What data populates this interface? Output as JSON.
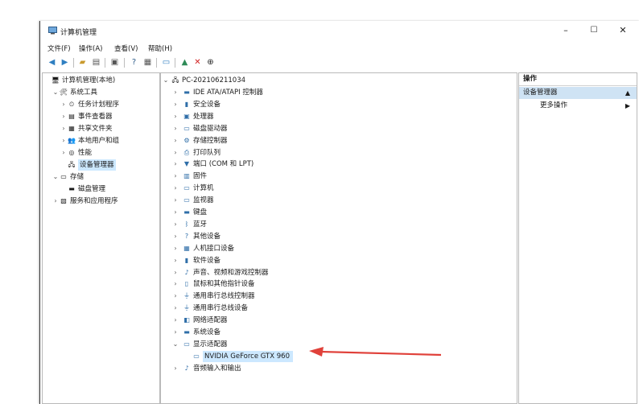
{
  "window": {
    "title": "计算机管理",
    "minimize": "–",
    "maximize": "☐",
    "close": "✕"
  },
  "menu": [
    "文件(F)",
    "操作(A)",
    "查看(V)",
    "帮助(H)"
  ],
  "left_tree": [
    {
      "label": "计算机管理(本地)",
      "level": 0,
      "chev": "",
      "icon": "computer-management-icon",
      "glyph": "🖥"
    },
    {
      "label": "系统工具",
      "level": 1,
      "chev": "v",
      "icon": "system-tools-icon",
      "glyph": "🛠"
    },
    {
      "label": "任务计划程序",
      "level": 2,
      "chev": ">",
      "icon": "task-scheduler-icon",
      "glyph": "⏲"
    },
    {
      "label": "事件查看器",
      "level": 2,
      "chev": ">",
      "icon": "event-viewer-icon",
      "glyph": "▤"
    },
    {
      "label": "共享文件夹",
      "level": 2,
      "chev": ">",
      "icon": "shared-folders-icon",
      "glyph": "▦"
    },
    {
      "label": "本地用户和组",
      "level": 2,
      "chev": ">",
      "icon": "users-icon",
      "glyph": "👥"
    },
    {
      "label": "性能",
      "level": 2,
      "chev": ">",
      "icon": "performance-icon",
      "glyph": "◎"
    },
    {
      "label": "设备管理器",
      "level": 2,
      "chev": "",
      "icon": "device-manager-icon",
      "glyph": "🖧",
      "selected": true
    },
    {
      "label": "存储",
      "level": 1,
      "chev": "v",
      "icon": "storage-icon",
      "glyph": "▭"
    },
    {
      "label": "磁盘管理",
      "level": 2,
      "chev": "",
      "icon": "disk-management-icon",
      "glyph": "▬"
    },
    {
      "label": "服务和应用程序",
      "level": 1,
      "chev": ">",
      "icon": "services-icon",
      "glyph": "▧"
    }
  ],
  "device_tree": {
    "root": "PC-202106211034",
    "categories": [
      {
        "label": "IDE ATA/ATAPI 控制器",
        "icon": "ide-controller-icon",
        "glyph": "▬"
      },
      {
        "label": "安全设备",
        "icon": "security-device-icon",
        "glyph": "▮"
      },
      {
        "label": "处理器",
        "icon": "processor-icon",
        "glyph": "▣"
      },
      {
        "label": "磁盘驱动器",
        "icon": "disk-drive-icon",
        "glyph": "▭"
      },
      {
        "label": "存储控制器",
        "icon": "storage-controller-icon",
        "glyph": "⚙"
      },
      {
        "label": "打印队列",
        "icon": "print-queue-icon",
        "glyph": "⎙"
      },
      {
        "label": "端口 (COM 和 LPT)",
        "icon": "port-icon",
        "glyph": "▼"
      },
      {
        "label": "固件",
        "icon": "firmware-icon",
        "glyph": "▥"
      },
      {
        "label": "计算机",
        "icon": "computer-icon",
        "glyph": "▭"
      },
      {
        "label": "监视器",
        "icon": "monitor-icon",
        "glyph": "▭"
      },
      {
        "label": "键盘",
        "icon": "keyboard-icon",
        "glyph": "▬"
      },
      {
        "label": "蓝牙",
        "icon": "bluetooth-icon",
        "glyph": "ᛒ"
      },
      {
        "label": "其他设备",
        "icon": "other-devices-icon",
        "glyph": "?"
      },
      {
        "label": "人机接口设备",
        "icon": "hid-icon",
        "glyph": "▦"
      },
      {
        "label": "软件设备",
        "icon": "software-device-icon",
        "glyph": "▮"
      },
      {
        "label": "声音、视频和游戏控制器",
        "icon": "sound-icon",
        "glyph": "♪"
      },
      {
        "label": "鼠标和其他指针设备",
        "icon": "mouse-icon",
        "glyph": "▯"
      },
      {
        "label": "通用串行总线控制器",
        "icon": "usb-controller-icon",
        "glyph": "⏚"
      },
      {
        "label": "通用串行总线设备",
        "icon": "usb-device-icon",
        "glyph": "⏚"
      },
      {
        "label": "网络适配器",
        "icon": "network-adapter-icon",
        "glyph": "◧"
      },
      {
        "label": "系统设备",
        "icon": "system-device-icon",
        "glyph": "▬"
      },
      {
        "label": "显示适配器",
        "icon": "display-adapter-icon",
        "glyph": "▭",
        "expanded": true
      },
      {
        "label": "NVIDIA GeForce GTX 960",
        "icon": "gpu-icon",
        "glyph": "▭",
        "child": true
      },
      {
        "label": "音频输入和输出",
        "icon": "audio-io-icon",
        "glyph": "♪"
      }
    ]
  },
  "actions": {
    "header": "操作",
    "section": "设备管理器",
    "more": "更多操作"
  },
  "colors": {
    "accent_arrow": "#e0413a",
    "selection": "#cce8ff",
    "section_bg": "#cfe3f4"
  }
}
